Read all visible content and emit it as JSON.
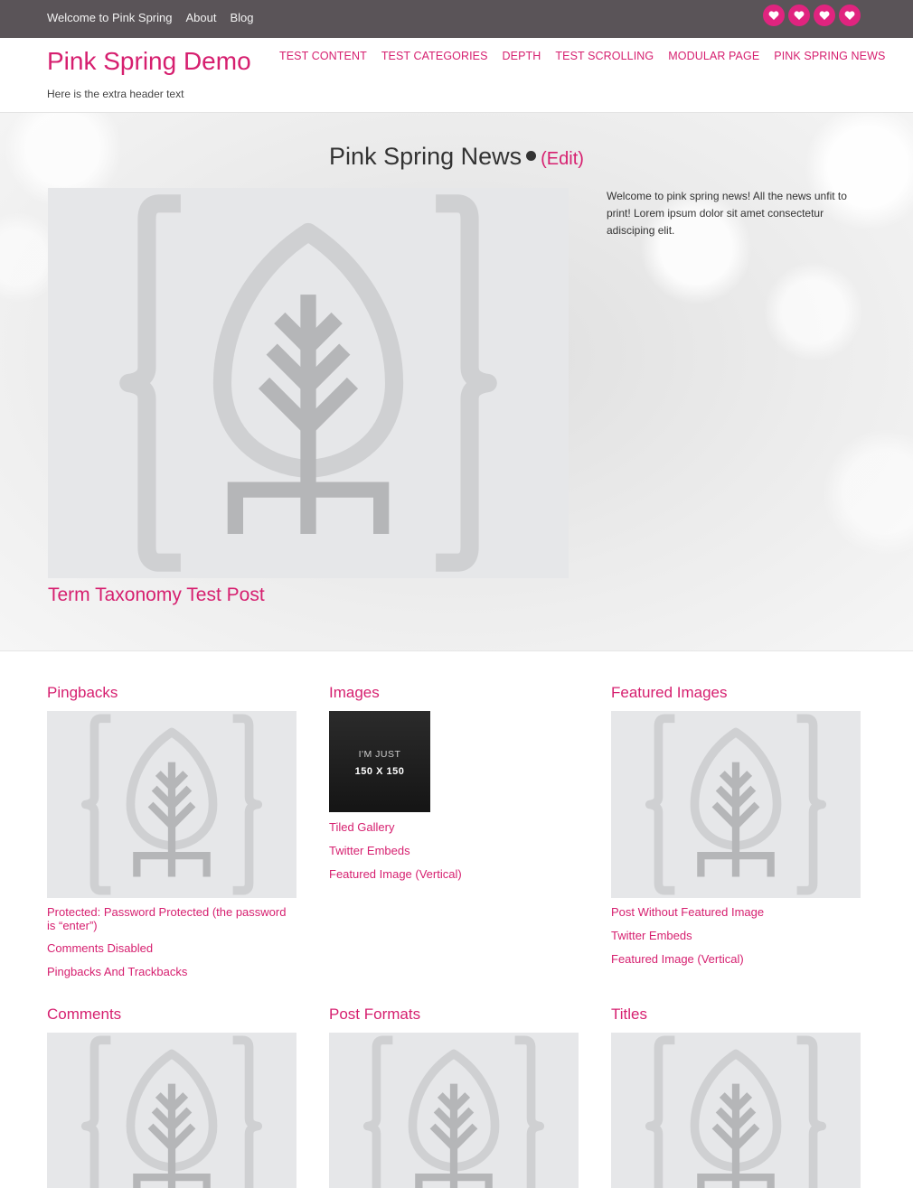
{
  "topbar": {
    "links": [
      "Welcome to Pink Spring",
      "About",
      "Blog"
    ],
    "social_icons": [
      "heart-icon",
      "heart-icon",
      "heart-icon",
      "heart-icon"
    ],
    "bar_color": "#5a5458",
    "icon_color": "#e0247f"
  },
  "header": {
    "site_title": "Pink Spring Demo",
    "tagline": "Here is the extra header text",
    "nav": [
      "Test Content",
      "Test Categories",
      "Depth",
      "Test Scrolling",
      "Modular Page",
      "Pink Spring News"
    ],
    "accent_color": "#d61f6f"
  },
  "hero": {
    "title": "Pink Spring News",
    "edit_label": "(Edit)",
    "description": "Welcome to pink spring news! All the news unfit to print! Lorem ipsum dolor sit amet consectetur adisciping elit.",
    "featured_post_title": "Term Taxonomy Test Post"
  },
  "sections": {
    "pingbacks": {
      "title": "Pingbacks",
      "links": [
        "Protected: Password Protected (the password is “enter”)",
        "Comments Disabled",
        "Pingbacks And Trackbacks"
      ]
    },
    "images": {
      "title": "Images",
      "thumb_line1": "I'M JUST",
      "thumb_line2": "150 X 150",
      "links": [
        "Tiled Gallery",
        "Twitter Embeds",
        "Featured Image (Vertical)"
      ]
    },
    "featured_images": {
      "title": "Featured Images",
      "links": [
        "Post Without Featured Image",
        "Twitter Embeds",
        "Featured Image (Vertical)"
      ]
    },
    "comments": {
      "title": "Comments"
    },
    "post_formats": {
      "title": "Post Formats"
    },
    "titles": {
      "title": "Titles"
    }
  }
}
